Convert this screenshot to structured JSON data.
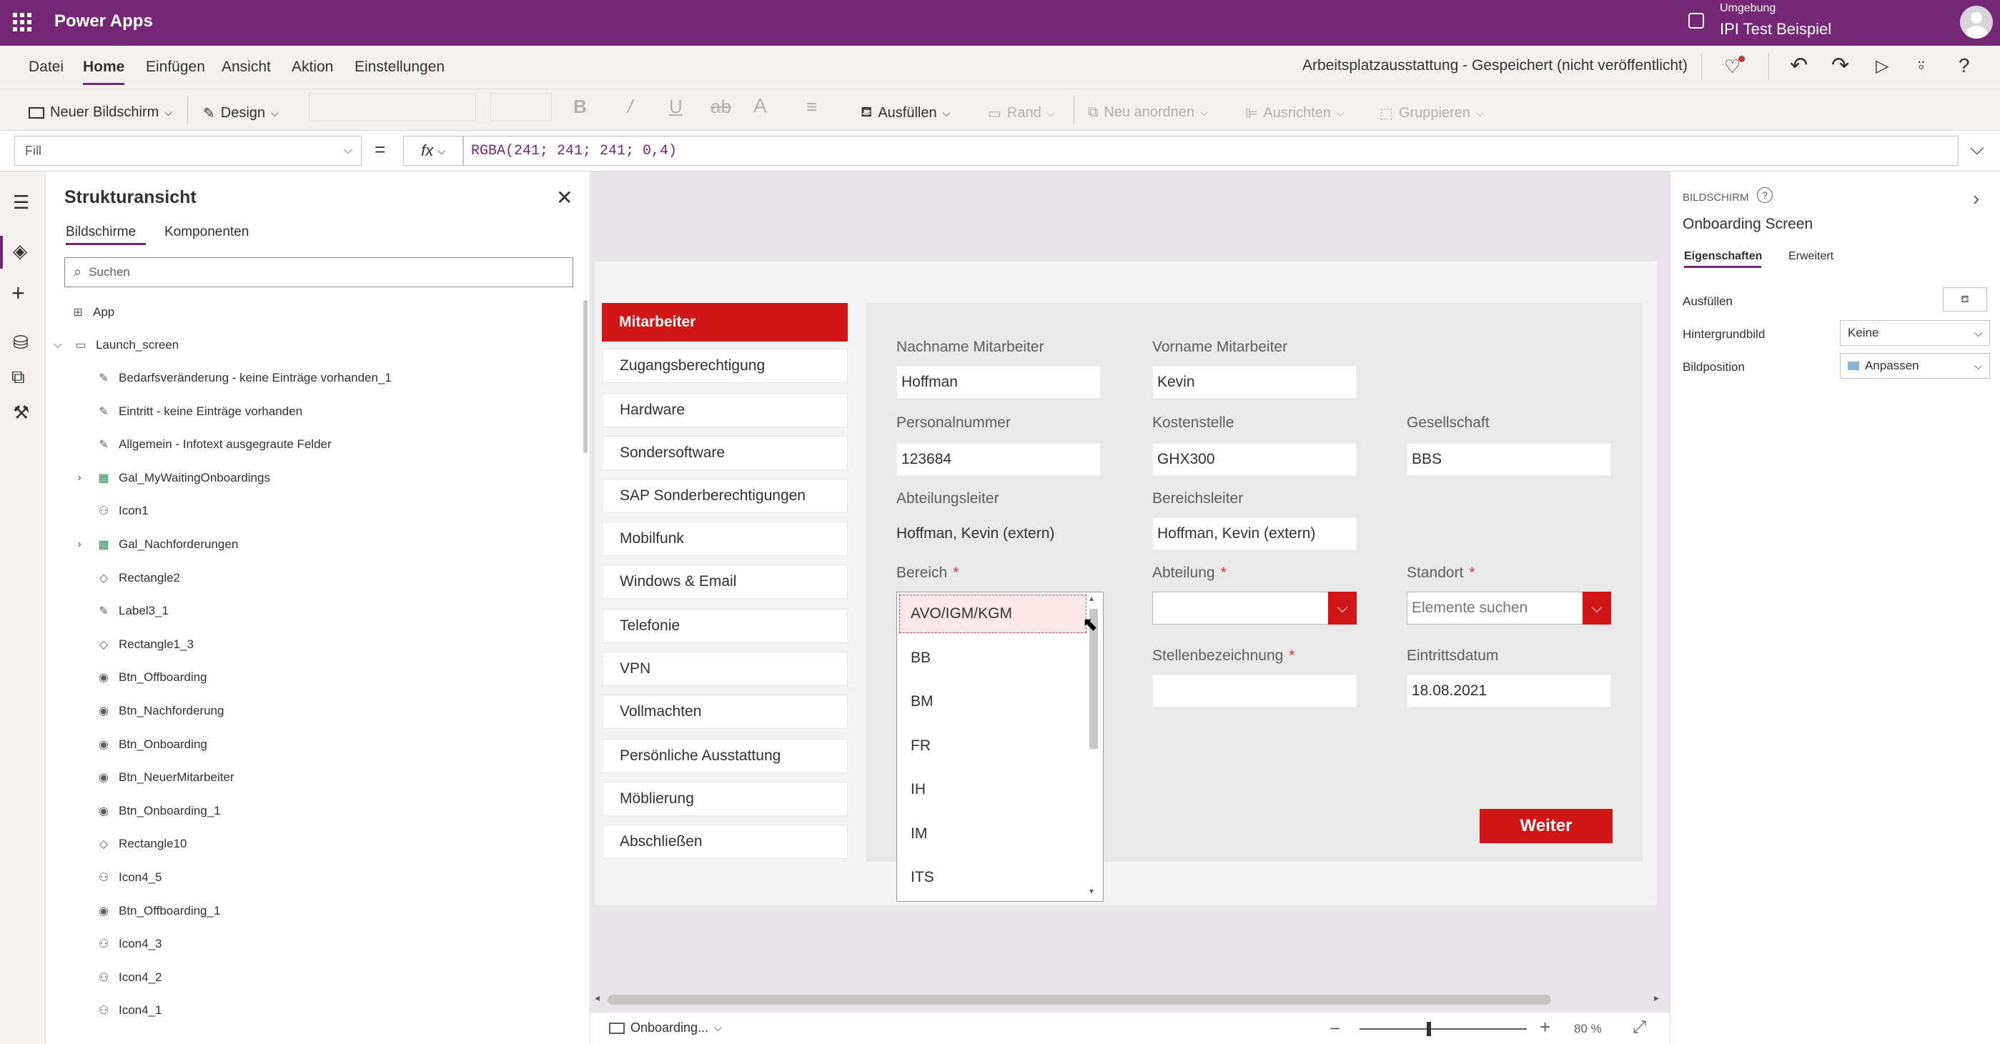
{
  "topbar": {
    "app_name": "Power Apps",
    "env_label": "Umgebung",
    "env_name": "IPI Test Beispiel"
  },
  "menu": {
    "items": [
      "Datei",
      "Home",
      "Einfügen",
      "Ansicht",
      "Aktion",
      "Einstellungen"
    ],
    "status": "Arbeitsplatzausstattung - Gespeichert (nicht veröffentlicht)"
  },
  "ribbon": {
    "new_screen": "Neuer Bildschirm",
    "design": "Design",
    "fill": "Ausfüllen",
    "border": "Rand",
    "reorder": "Neu anordnen",
    "align": "Ausrichten",
    "group": "Gruppieren"
  },
  "formula": {
    "property": "Fill",
    "fx": "fx",
    "equals": "=",
    "value": "RGBA(241; 241; 241; 0,4)"
  },
  "tree": {
    "title": "Strukturansicht",
    "tab_screens": "Bildschirme",
    "tab_components": "Komponenten",
    "search_placeholder": "Suchen",
    "app_label": "App",
    "screen_label": "Launch_screen",
    "items": [
      {
        "label": "Bedarfsveränderung - keine Einträge vorhanden_1",
        "icon": "label-icon"
      },
      {
        "label": "Eintritt - keine Einträge vorhanden",
        "icon": "label-icon"
      },
      {
        "label": "Allgemein - Infotext ausgegraute Felder",
        "icon": "label-icon"
      },
      {
        "label": "Gal_MyWaitingOnboardings",
        "icon": "gallery-icon"
      },
      {
        "label": "Icon1",
        "icon": "icon-control-icon"
      },
      {
        "label": "Gal_Nachforderungen",
        "icon": "gallery-icon"
      },
      {
        "label": "Rectangle2",
        "icon": "shape-icon"
      },
      {
        "label": "Label3_1",
        "icon": "label-icon"
      },
      {
        "label": "Rectangle1_3",
        "icon": "shape-icon"
      },
      {
        "label": "Btn_Offboarding",
        "icon": "button-icon"
      },
      {
        "label": "Btn_Nachforderung",
        "icon": "button-icon"
      },
      {
        "label": "Btn_Onboarding",
        "icon": "button-icon"
      },
      {
        "label": "Btn_NeuerMitarbeiter",
        "icon": "button-icon"
      },
      {
        "label": "Btn_Onboarding_1",
        "icon": "button-icon"
      },
      {
        "label": "Rectangle10",
        "icon": "shape-icon"
      },
      {
        "label": "Icon4_5",
        "icon": "icon-control-icon"
      },
      {
        "label": "Btn_Offboarding_1",
        "icon": "button-icon"
      },
      {
        "label": "Icon4_3",
        "icon": "icon-control-icon"
      },
      {
        "label": "Icon4_2",
        "icon": "icon-control-icon"
      },
      {
        "label": "Icon4_1",
        "icon": "icon-control-icon"
      }
    ]
  },
  "app": {
    "nav": [
      "Mitarbeiter",
      "Zugangsberechtigung",
      "Hardware",
      "Sondersoftware",
      "SAP Sonderberechtigungen",
      "Mobilfunk",
      "Windows & Email",
      "Telefonie",
      "VPN",
      "Vollmachten",
      "Persönliche Ausstattung",
      "Möblierung",
      "Abschließen"
    ],
    "fields": {
      "nachname_label": "Nachname Mitarbeiter",
      "nachname_value": "Hoffman",
      "vorname_label": "Vorname Mitarbeiter",
      "vorname_value": "Kevin",
      "personal_label": "Personalnummer",
      "personal_value": "123684",
      "kosten_label": "Kostenstelle",
      "kosten_value": "GHX300",
      "gesell_label": "Gesellschaft",
      "gesell_value": "BBS",
      "abtleiter_label": "Abteilungsleiter",
      "abtleiter_value": "Hoffman, Kevin (extern)",
      "berleiter_label": "Bereichsleiter",
      "berleiter_value": "Hoffman, Kevin (extern)",
      "bereich_label": "Bereich",
      "abteilung_label": "Abteilung",
      "standort_label": "Standort",
      "standort_placeholder": "Elemente suchen",
      "stelle_label": "Stellenbezeichnung",
      "eintritt_label": "Eintrittsdatum",
      "eintritt_value": "18.08.2021",
      "required_mark": "*"
    },
    "bereich_options": [
      "AVO/IGM/KGM",
      "BB",
      "BM",
      "FR",
      "IH",
      "IM",
      "ITS"
    ],
    "next_button": "Weiter"
  },
  "bottom": {
    "screen_tab": "Onboarding...",
    "zoom": "80",
    "zoom_unit": "%"
  },
  "props": {
    "section": "BILDSCHIRM",
    "screen_name": "Onboarding Screen",
    "tab_properties": "Eigenschaften",
    "tab_advanced": "Erweitert",
    "fill_label": "Ausfüllen",
    "bgimage_label": "Hintergrundbild",
    "bgimage_value": "Keine",
    "imgpos_label": "Bildposition",
    "imgpos_value": "Anpassen"
  },
  "colors": {
    "brand": "#742774",
    "accent_red": "#d01616"
  }
}
